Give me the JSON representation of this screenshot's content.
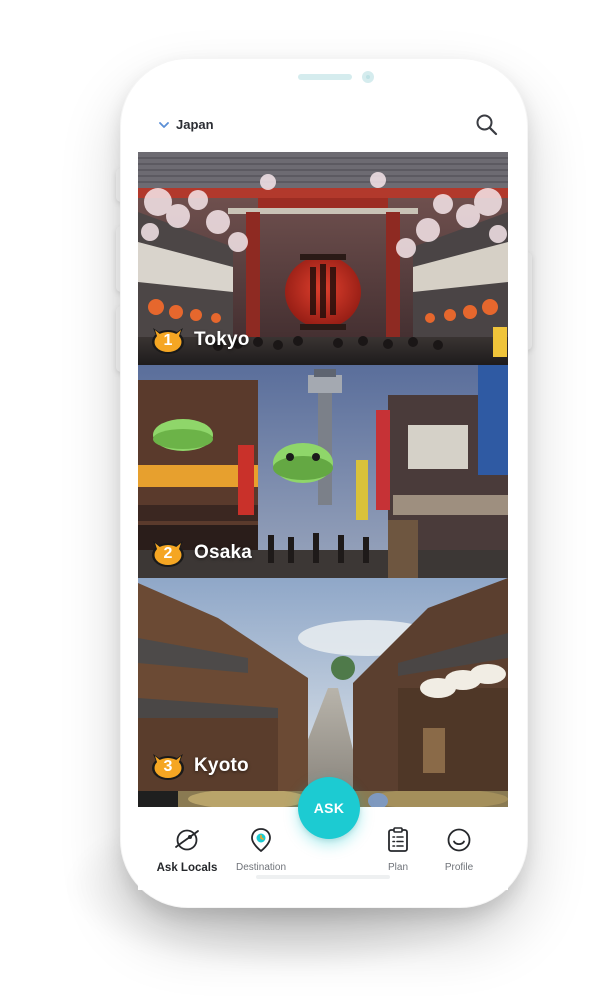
{
  "header": {
    "country": "Japan",
    "chevron_icon": "chevron-down-icon",
    "search_icon": "search-icon"
  },
  "cities": [
    {
      "rank": "1",
      "name": "Tokyo",
      "badge_icon": "cat-face-badge-icon"
    },
    {
      "rank": "2",
      "name": "Osaka",
      "badge_icon": "cat-face-badge-icon"
    },
    {
      "rank": "3",
      "name": "Kyoto",
      "badge_icon": "cat-face-badge-icon"
    }
  ],
  "fab": {
    "label": "ASK"
  },
  "nav": {
    "items": [
      {
        "label": "Ask Locals",
        "icon": "planet-icon",
        "active": true
      },
      {
        "label": "Destination",
        "icon": "map-pin-icon",
        "active": false
      },
      {
        "label": "Plan",
        "icon": "checklist-icon",
        "active": false
      },
      {
        "label": "Profile",
        "icon": "smiley-icon",
        "active": false
      }
    ]
  },
  "colors": {
    "accent": "#1ccbd2",
    "badge": "#f5a623",
    "chevron": "#5b8fd6",
    "text_dark": "#2b2d33",
    "text_muted": "#6f7379"
  }
}
